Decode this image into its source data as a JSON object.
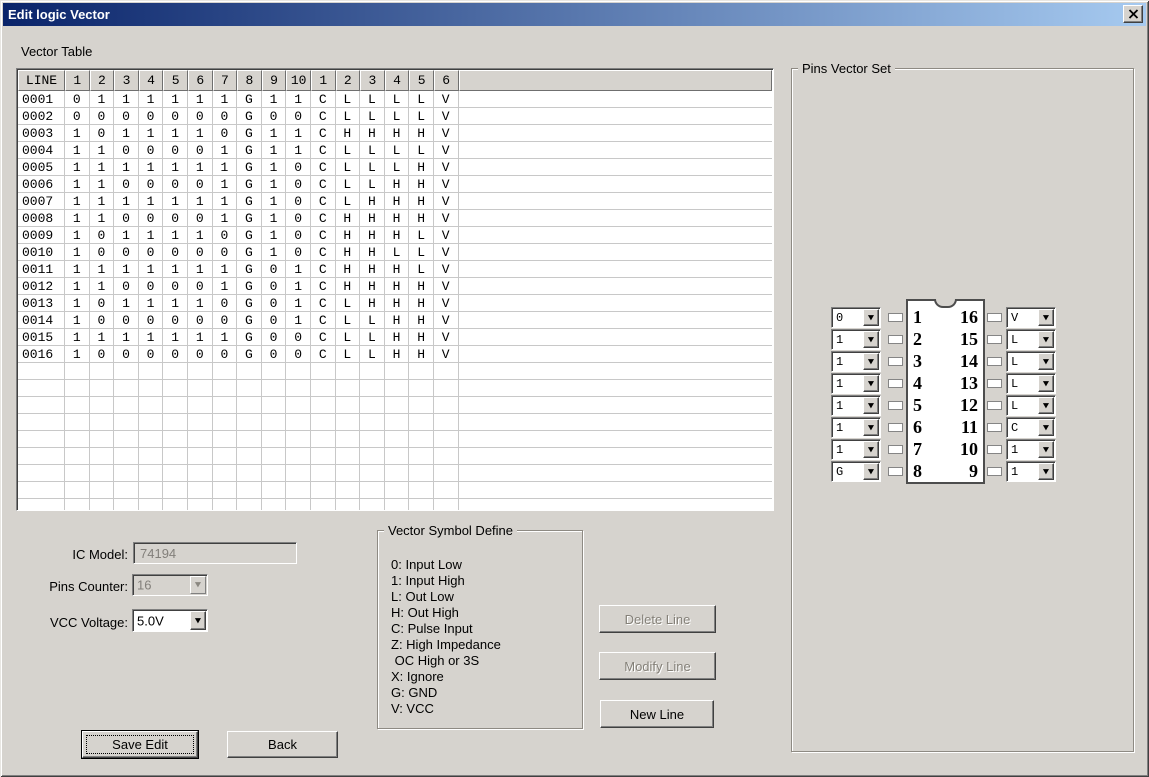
{
  "window": {
    "title": "Edit logic Vector"
  },
  "colors": {
    "dialog_bg": "#d6d3ce",
    "titlebar_gradient_start": "#0a246a",
    "titlebar_gradient_end": "#a6caf0",
    "disabled_text": "#848078",
    "gridline": "#c8c8c8"
  },
  "vector_table": {
    "label": "Vector Table",
    "headers": [
      "LINE",
      "1",
      "2",
      "3",
      "4",
      "5",
      "6",
      "7",
      "8",
      "9",
      "10",
      "1",
      "2",
      "3",
      "4",
      "5",
      "6"
    ],
    "rows": [
      {
        "line": "0001",
        "values": [
          "0",
          "1",
          "1",
          "1",
          "1",
          "1",
          "1",
          "G",
          "1",
          "1",
          "C",
          "L",
          "L",
          "L",
          "L",
          "V"
        ]
      },
      {
        "line": "0002",
        "values": [
          "0",
          "0",
          "0",
          "0",
          "0",
          "0",
          "0",
          "G",
          "0",
          "0",
          "C",
          "L",
          "L",
          "L",
          "L",
          "V"
        ]
      },
      {
        "line": "0003",
        "values": [
          "1",
          "0",
          "1",
          "1",
          "1",
          "1",
          "0",
          "G",
          "1",
          "1",
          "C",
          "H",
          "H",
          "H",
          "H",
          "V"
        ]
      },
      {
        "line": "0004",
        "values": [
          "1",
          "1",
          "0",
          "0",
          "0",
          "0",
          "1",
          "G",
          "1",
          "1",
          "C",
          "L",
          "L",
          "L",
          "L",
          "V"
        ]
      },
      {
        "line": "0005",
        "values": [
          "1",
          "1",
          "1",
          "1",
          "1",
          "1",
          "1",
          "G",
          "1",
          "0",
          "C",
          "L",
          "L",
          "L",
          "H",
          "V"
        ]
      },
      {
        "line": "0006",
        "values": [
          "1",
          "1",
          "0",
          "0",
          "0",
          "0",
          "1",
          "G",
          "1",
          "0",
          "C",
          "L",
          "L",
          "H",
          "H",
          "V"
        ]
      },
      {
        "line": "0007",
        "values": [
          "1",
          "1",
          "1",
          "1",
          "1",
          "1",
          "1",
          "G",
          "1",
          "0",
          "C",
          "L",
          "H",
          "H",
          "H",
          "V"
        ]
      },
      {
        "line": "0008",
        "values": [
          "1",
          "1",
          "0",
          "0",
          "0",
          "0",
          "1",
          "G",
          "1",
          "0",
          "C",
          "H",
          "H",
          "H",
          "H",
          "V"
        ]
      },
      {
        "line": "0009",
        "values": [
          "1",
          "0",
          "1",
          "1",
          "1",
          "1",
          "0",
          "G",
          "1",
          "0",
          "C",
          "H",
          "H",
          "H",
          "L",
          "V"
        ]
      },
      {
        "line": "0010",
        "values": [
          "1",
          "0",
          "0",
          "0",
          "0",
          "0",
          "0",
          "G",
          "1",
          "0",
          "C",
          "H",
          "H",
          "L",
          "L",
          "V"
        ]
      },
      {
        "line": "0011",
        "values": [
          "1",
          "1",
          "1",
          "1",
          "1",
          "1",
          "1",
          "G",
          "0",
          "1",
          "C",
          "H",
          "H",
          "H",
          "L",
          "V"
        ]
      },
      {
        "line": "0012",
        "values": [
          "1",
          "1",
          "0",
          "0",
          "0",
          "0",
          "1",
          "G",
          "0",
          "1",
          "C",
          "H",
          "H",
          "H",
          "H",
          "V"
        ]
      },
      {
        "line": "0013",
        "values": [
          "1",
          "0",
          "1",
          "1",
          "1",
          "1",
          "0",
          "G",
          "0",
          "1",
          "C",
          "L",
          "H",
          "H",
          "H",
          "V"
        ]
      },
      {
        "line": "0014",
        "values": [
          "1",
          "0",
          "0",
          "0",
          "0",
          "0",
          "0",
          "G",
          "0",
          "1",
          "C",
          "L",
          "L",
          "H",
          "H",
          "V"
        ]
      },
      {
        "line": "0015",
        "values": [
          "1",
          "1",
          "1",
          "1",
          "1",
          "1",
          "1",
          "G",
          "0",
          "0",
          "C",
          "L",
          "L",
          "H",
          "H",
          "V"
        ]
      },
      {
        "line": "0016",
        "values": [
          "1",
          "0",
          "0",
          "0",
          "0",
          "0",
          "0",
          "G",
          "0",
          "0",
          "C",
          "L",
          "L",
          "H",
          "H",
          "V"
        ]
      }
    ]
  },
  "form": {
    "ic_model": {
      "label": "IC Model:",
      "value": "74194"
    },
    "pins_counter": {
      "label": "Pins Counter:",
      "value": "16"
    },
    "vcc_voltage": {
      "label": "VCC Voltage:",
      "value": "5.0V"
    }
  },
  "symbol_define": {
    "title": "Vector Symbol Define",
    "lines": [
      "0: Input Low",
      "1: Input High",
      "L: Out Low",
      "H: Out High",
      "C: Pulse Input",
      "Z: High Impedance",
      " OC High or 3S",
      "X: Ignore",
      "G: GND",
      "V: VCC"
    ]
  },
  "buttons": {
    "delete_line": "Delete Line",
    "modify_line": "Modify Line",
    "new_line": "New Line",
    "save_edit": "Save Edit",
    "back": "Back"
  },
  "pins_vector_set": {
    "title": "Pins Vector Set",
    "left_pins": [
      {
        "pin": "1",
        "value": "0"
      },
      {
        "pin": "2",
        "value": "1"
      },
      {
        "pin": "3",
        "value": "1"
      },
      {
        "pin": "4",
        "value": "1"
      },
      {
        "pin": "5",
        "value": "1"
      },
      {
        "pin": "6",
        "value": "1"
      },
      {
        "pin": "7",
        "value": "1"
      },
      {
        "pin": "8",
        "value": "G"
      }
    ],
    "right_pins": [
      {
        "pin": "16",
        "value": "V"
      },
      {
        "pin": "15",
        "value": "L"
      },
      {
        "pin": "14",
        "value": "L"
      },
      {
        "pin": "13",
        "value": "L"
      },
      {
        "pin": "12",
        "value": "L"
      },
      {
        "pin": "11",
        "value": "C"
      },
      {
        "pin": "10",
        "value": "1"
      },
      {
        "pin": "9",
        "value": "1"
      }
    ]
  }
}
